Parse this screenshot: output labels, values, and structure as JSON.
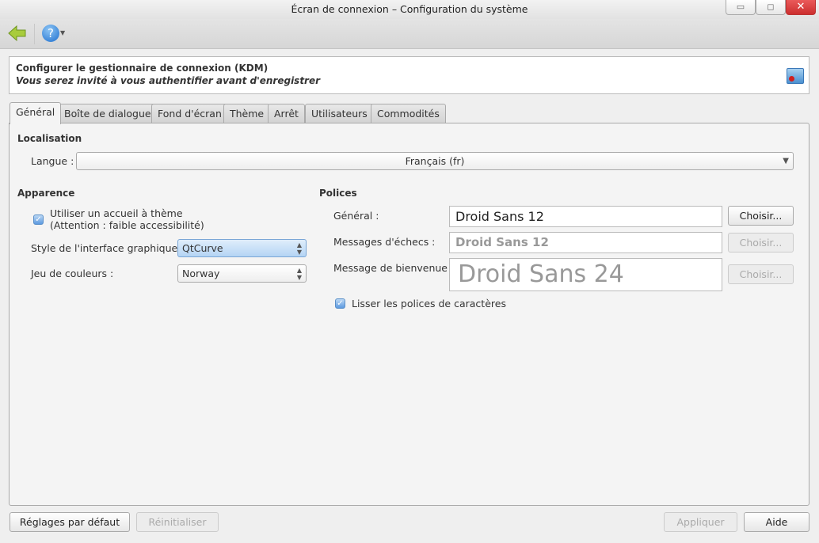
{
  "window": {
    "title": "Écran de connexion – Configuration du système"
  },
  "header": {
    "title": "Configurer le gestionnaire de connexion (KDM)",
    "subtitle": "Vous serez invité à vous authentifier avant d'enregistrer"
  },
  "tabs": [
    "Général",
    "Boîte de dialogue",
    "Fond d'écran",
    "Thème",
    "Arrêt",
    "Utilisateurs",
    "Commodités"
  ],
  "localisation": {
    "heading": "Localisation",
    "langue_label": "Langue :",
    "langue_value": "Français (fr)"
  },
  "apparence": {
    "heading": "Apparence",
    "theme_checkbox": "Utiliser un accueil à thème",
    "theme_note": "(Attention : faible accessibilité)",
    "theme_checked": true,
    "style_label": "Style de l'interface graphique :",
    "style_value": "QtCurve",
    "colors_label": "Jeu de couleurs :",
    "colors_value": "Norway"
  },
  "polices": {
    "heading": "Polices",
    "general_label": "Général :",
    "general_value": "Droid Sans 12",
    "echecs_label": "Messages d'échecs :",
    "echecs_value": "Droid Sans 12",
    "bienvenue_label": "Message de bienvenue :",
    "bienvenue_value": "Droid Sans 24",
    "choose_label": "Choisir...",
    "smooth_label": "Lisser les polices de caractères",
    "smooth_checked": true
  },
  "footer": {
    "defaults": "Réglages par défaut",
    "reset": "Réinitialiser",
    "apply": "Appliquer",
    "help": "Aide"
  }
}
